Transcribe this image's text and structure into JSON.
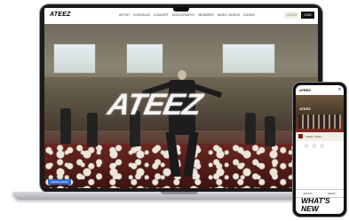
{
  "laptop": {
    "site": {
      "logo": "ATEEZ",
      "nav_links": [
        "ARTIST",
        "SCHEDULE",
        "CONCERT",
        "DISCOGRAPHY",
        "MEMBERS",
        "MUSIC VIDEOS",
        "GOODS"
      ],
      "nav_button_alt": "LOG IN",
      "nav_button": "JOIN",
      "hero_logo": "ATEEZ",
      "hero_tag": "WATCH NOW"
    }
  },
  "phone": {
    "logo": "ATEEZ",
    "menu_icon": "menu-icon",
    "banner_text": "ATEEZ",
    "strip_text": "ATEEZ ITEMS",
    "icons": "◯ ◯ ◯",
    "tabs": [
      "ARTIST",
      "NEWS"
    ],
    "heading": "WHAT'S\nNEW"
  },
  "colors": {
    "hero_floor": "#5a2a23",
    "nav_button_bg": "#111111",
    "tag_blue": "#2b6fd6"
  }
}
